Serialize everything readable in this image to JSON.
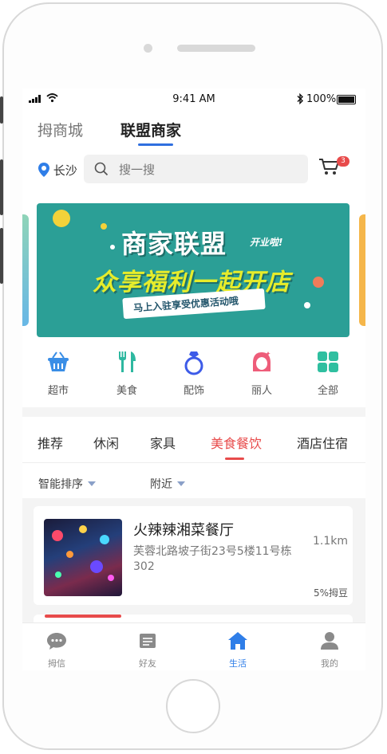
{
  "status_bar": {
    "time": "9:41 AM",
    "battery": "100%"
  },
  "top_tabs": [
    "拇商城",
    "联盟商家"
  ],
  "location": "长沙",
  "search": {
    "placeholder": "搜一搜"
  },
  "cart_badge": "3",
  "banner": {
    "title": "商家联盟",
    "tag": "开业啦!",
    "subtitle": "众享福利一起开店",
    "ribbon": "马上入驻享受优惠活动哦"
  },
  "categories": [
    {
      "label": "超市",
      "icon": "basket-icon",
      "color": "#3a8ee6"
    },
    {
      "label": "美食",
      "icon": "fork-knife-icon",
      "color": "#2eb8a0"
    },
    {
      "label": "配饰",
      "icon": "ring-icon",
      "color": "#3d5be8"
    },
    {
      "label": "丽人",
      "icon": "woman-icon",
      "color": "#ee5d7a"
    },
    {
      "label": "全部",
      "icon": "grid-icon",
      "color": "#2fbfa0"
    }
  ],
  "sub_tabs": [
    "推荐",
    "休闲",
    "家具",
    "美食餐饮",
    "酒店住宿"
  ],
  "active_sub_tab": "美食餐饮",
  "sort": [
    "智能排序",
    "附近"
  ],
  "shops": [
    {
      "name": "火辣辣湘菜餐厅",
      "address": "芙蓉北路坡子街23号5楼11号栋302",
      "distance": "1.1km",
      "bonus": "5%拇豆"
    }
  ],
  "bottom_nav": [
    {
      "label": "拇信",
      "icon": "chat-icon"
    },
    {
      "label": "好友",
      "icon": "contacts-icon"
    },
    {
      "label": "生活",
      "icon": "home-icon"
    },
    {
      "label": "我的",
      "icon": "user-icon"
    }
  ],
  "active_nav": "生活"
}
